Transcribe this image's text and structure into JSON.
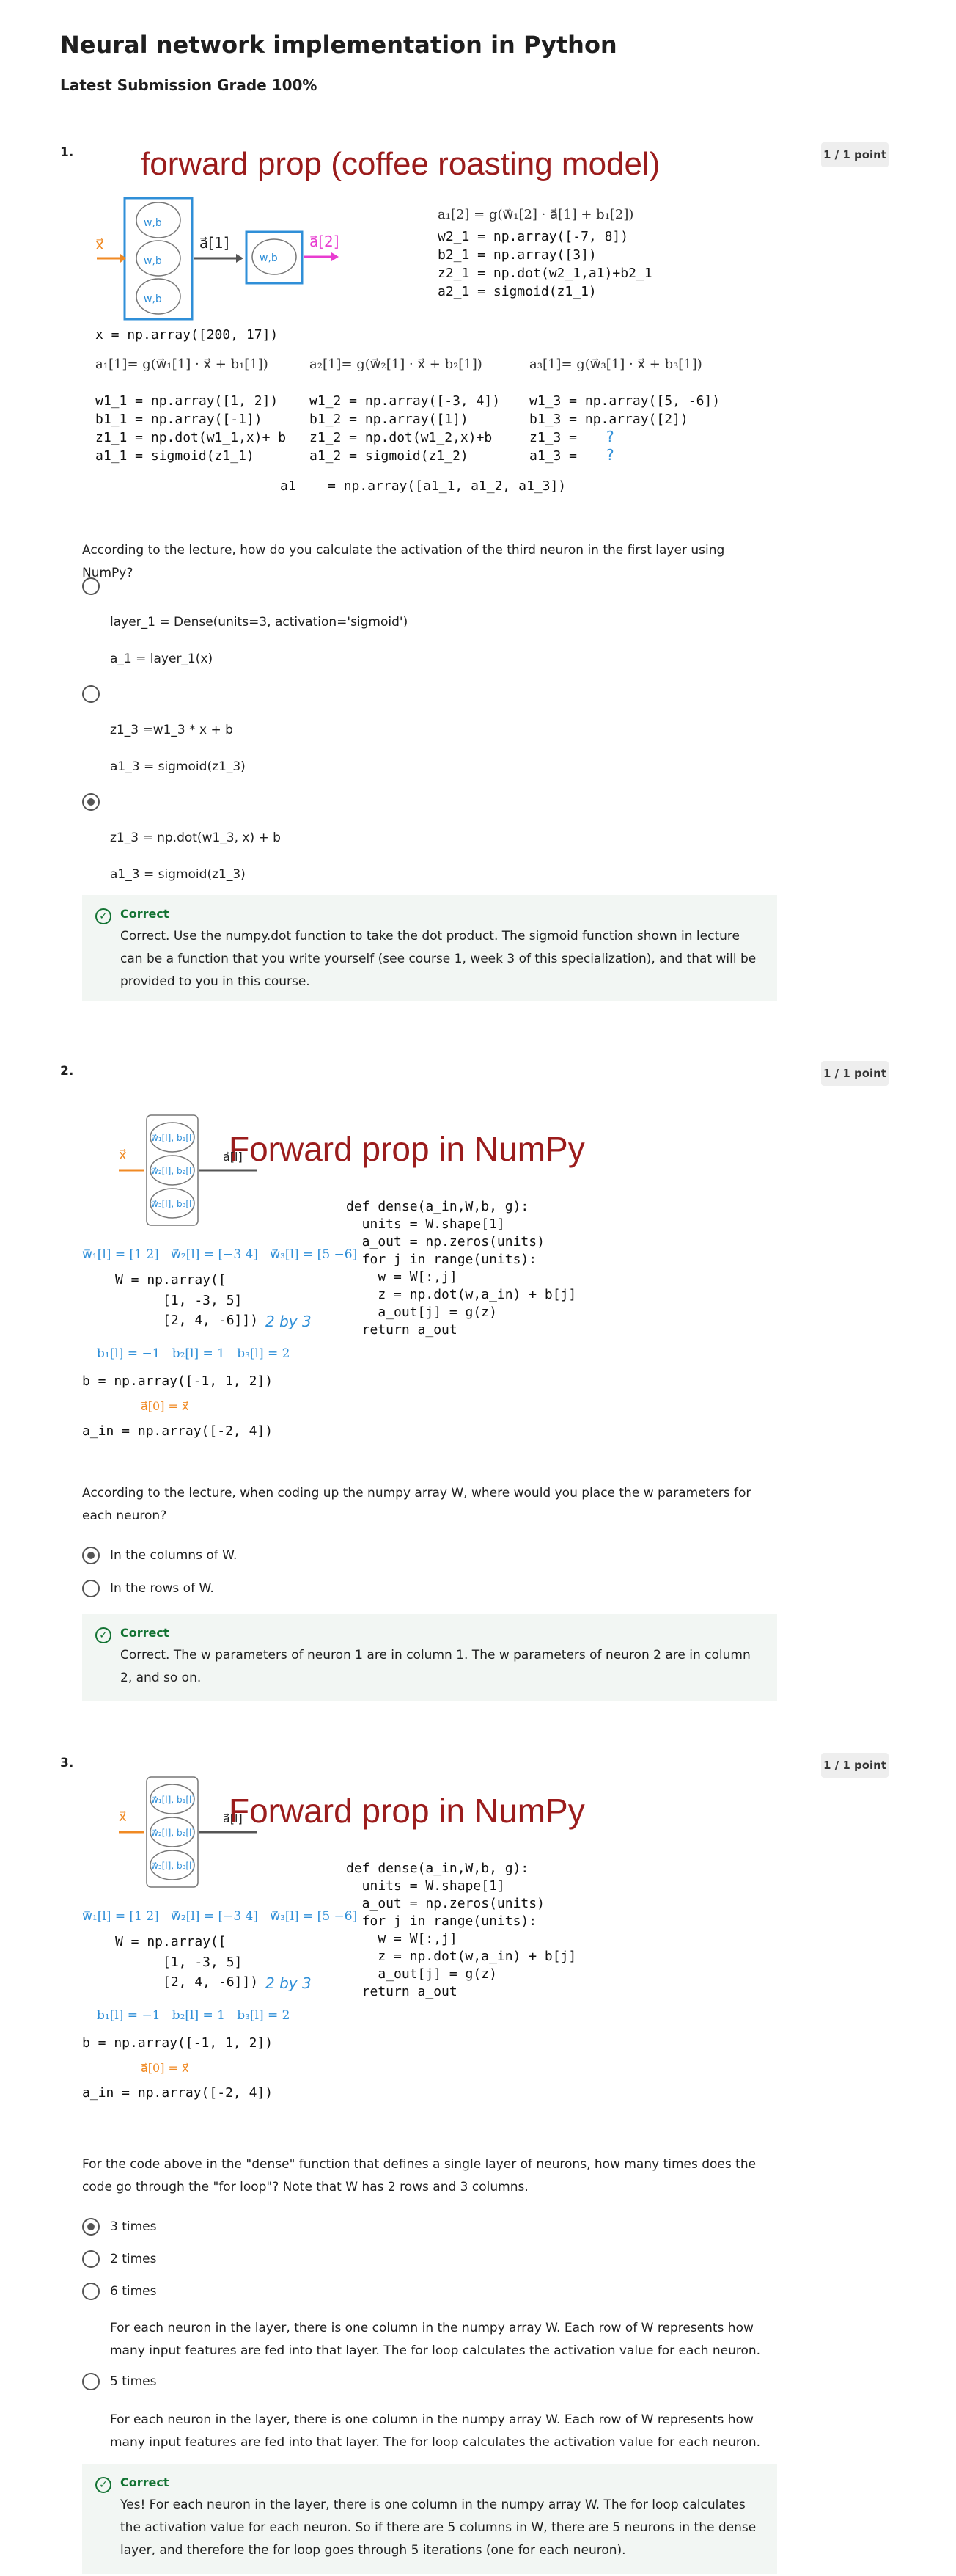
{
  "page": {
    "title": "Neural network implementation in Python",
    "grade": "Latest Submission Grade 100%"
  },
  "q1": {
    "number": "1.",
    "points": "1 / 1 point",
    "fig": {
      "title": "forward prop (coffee roasting model)",
      "x_label": "x⃗",
      "a1_label": "a⃗[1]",
      "a2_label": "a⃗[2]",
      "top_formula": "a₁[2] = g(w⃗₁[2] · a⃗[1] + b₁[2])",
      "top_code": [
        "w2_1 = np.array([-7, 8])",
        "b2_1 = np.array([3])",
        "z2_1 = np.dot(w2_1,a1)+b2_1",
        "a2_1 = sigmoid(z1_1)"
      ],
      "x_code": "x = np.array([200, 17])",
      "formulas": [
        "a₁[1]= g(w⃗₁[1] · x⃗ + b₁[1])",
        "a₂[1]= g(w⃗₂[1] · x⃗ + b₂[1])",
        "a₃[1]= g(w⃗₃[1] · x⃗ + b₃[1])"
      ],
      "col1": [
        "w1_1 = np.array([1, 2])",
        "b1_1 = np.array([-1])",
        "z1_1 = np.dot(w1_1,x)+ b",
        "a1_1 = sigmoid(z1_1)"
      ],
      "col2": [
        "w1_2 = np.array([-3, 4])",
        "b1_2 = np.array([1])",
        "z1_2 = np.dot(w1_2,x)+b",
        "a1_2 = sigmoid(z1_2)"
      ],
      "col3": [
        "w1_3 = np.array([5, -6])",
        "b1_3 = np.array([2])",
        "z1_3 =",
        "a1_3 ="
      ],
      "a1_line": "a1    = np.array([a1_1, a1_2, a1_3])",
      "q_mark": "?"
    },
    "question": "According to the lecture, how do you calculate the activation of the third neuron in the first layer using NumPy?",
    "options": [
      {
        "line1": "layer_1 = Dense(units=3, activation='sigmoid')",
        "line2": "a_1 = layer_1(x)"
      },
      {
        "line1": "z1_3 =w1_3 * x + b",
        "line2": "a1_3 = sigmoid(z1_3)"
      },
      {
        "line1": "z1_3 = np.dot(w1_3, x) + b",
        "line2": "a1_3 = sigmoid(z1_3)"
      }
    ],
    "feedback_label": "Correct",
    "feedback_text": "Correct. Use the numpy.dot function to take the dot product. The sigmoid function shown in lecture can be a function that you write yourself (see course 1, week 3 of this specialization), and that will be provided to you in this course."
  },
  "q2": {
    "number": "2.",
    "points": "1 / 1 point",
    "question": "According to the lecture, when coding up the numpy array W, where would you place the w parameters for each neuron?",
    "options": [
      "In the columns of W.",
      "In the rows of W."
    ],
    "feedback_label": "Correct",
    "feedback_text": "Correct. The w parameters of neuron 1 are in column 1. The w parameters of neuron 2 are in column 2, and so on."
  },
  "q3": {
    "number": "3.",
    "points": "1 / 1 point",
    "question": "For the code above in the \"dense\" function that defines a single layer of neurons, how many times does the code go through the \"for loop\"? Note that W has 2 rows and 3 columns.",
    "options": [
      "3 times",
      "2 times",
      "6 times",
      "5 times"
    ],
    "explain": "For each neuron in the layer, there is one column in the numpy array W. Each row of W represents how many input features are fed into that layer. The for loop calculates the activation value for each neuron.",
    "feedback_label": "Correct",
    "feedback_text": "Yes! For each neuron in the layer, there is one column in the numpy array W. The for loop calculates the activation value for each neuron. So if there are 5 columns in W, there are 5 neurons in the dense layer, and therefore the for loop goes through 5 iterations (one for each neuron)."
  },
  "numpy_fig": {
    "title": "Forward prop in NumPy",
    "x_label": "x⃗",
    "a_label": "a⃗[l]",
    "neurons": [
      "w⃗₁[l], b₁[l]",
      "w⃗₂[l], b₂[l]",
      "w⃗₃[l], b₃[l]"
    ],
    "w_vectors": "w⃗₁[l] = [1 2]   w⃗₂[l] = [−3 4]   w⃗₃[l] = [5 −6]",
    "w_code": "W = np.array([",
    "w_row1": "[1, -3, 5]",
    "w_row2": "[2, 4, -6]])",
    "note": "2 by 3",
    "b_values": "b₁[l] = −1   b₂[l] = 1   b₃[l] = 2",
    "b_code": "b = np.array([-1, 1, 2])",
    "a0": "a⃗[0] = x⃗",
    "a_in_code": "a_in = np.array([-2, 4])",
    "dense_code": [
      "def dense(a_in,W,b, g):",
      "  units = W.shape[1]",
      "  a_out = np.zeros(units)",
      "  for j in range(units):",
      "    w = W[:,j]",
      "    z = np.dot(w,a_in) + b[j]",
      "    a_out[j] = g(z)",
      "  return a_out"
    ]
  },
  "colors": {
    "title_red": "#9b1c1c",
    "blue": "#2f8fd8",
    "orange": "#f08a24",
    "magenta": "#e83cd0",
    "green": "#137333"
  }
}
